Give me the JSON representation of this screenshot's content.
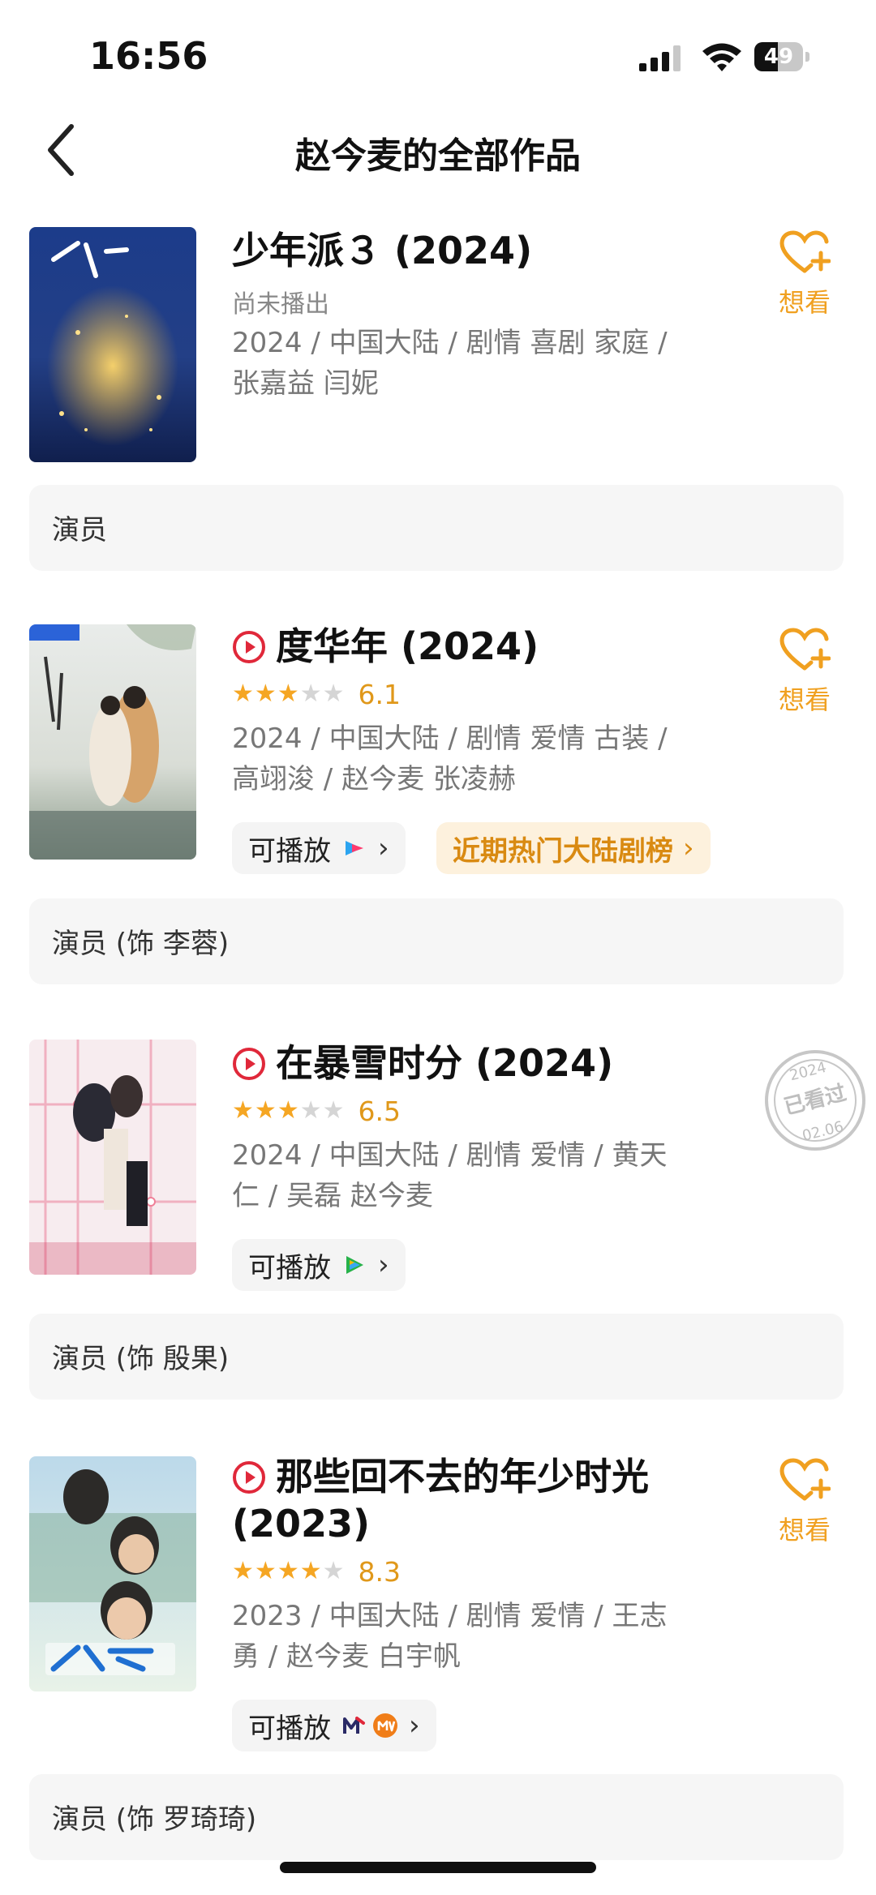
{
  "status_bar": {
    "time": "16:56",
    "battery": "49",
    "battery_level": 0.49
  },
  "nav": {
    "title": "赵今麦的全部作品"
  },
  "want_label": "想看",
  "works": [
    {
      "title": "少年派３ (2024)",
      "status": "尚未播出",
      "meta_line1": "2024 / 中国大陆 / 剧情 喜剧 家庭 /",
      "meta_line2": "张嘉益 闫妮",
      "role": "演员"
    },
    {
      "title": "度华年 (2024)",
      "stars": 3,
      "rating": "6.1",
      "meta_line1": "2024 / 中国大陆 / 剧情 爱情 古装 /",
      "meta_line2": "高翊浚 / 赵今麦 张凌赫",
      "playable": "可播放",
      "rank": "近期热门大陆剧榜",
      "role": "演员 (饰 李蓉)"
    },
    {
      "title": "在暴雪时分 (2024)",
      "stars": 3,
      "rating": "6.5",
      "meta_line1": "2024 / 中国大陆 / 剧情 爱情 / 黄天",
      "meta_line2": "仁 / 吴磊 赵今麦",
      "playable": "可播放",
      "role": "演员 (饰 殷果)",
      "stamp": {
        "line1": "2024",
        "line2": "已看过",
        "line3": "02.06"
      }
    },
    {
      "title_line1": "那些回不去的年少时光",
      "title_line2": "(2023)",
      "stars": 4,
      "rating": "8.3",
      "meta_line1": "2023 / 中国大陆 / 剧情 爱情 / 王志",
      "meta_line2": "勇 / 赵今麦 白宇帆",
      "playable": "可播放",
      "role": "演员 (饰 罗琦琦)"
    }
  ],
  "colors": {
    "accent": "#f0a020",
    "play_red": "#e0283a",
    "star": "#f5a623"
  }
}
